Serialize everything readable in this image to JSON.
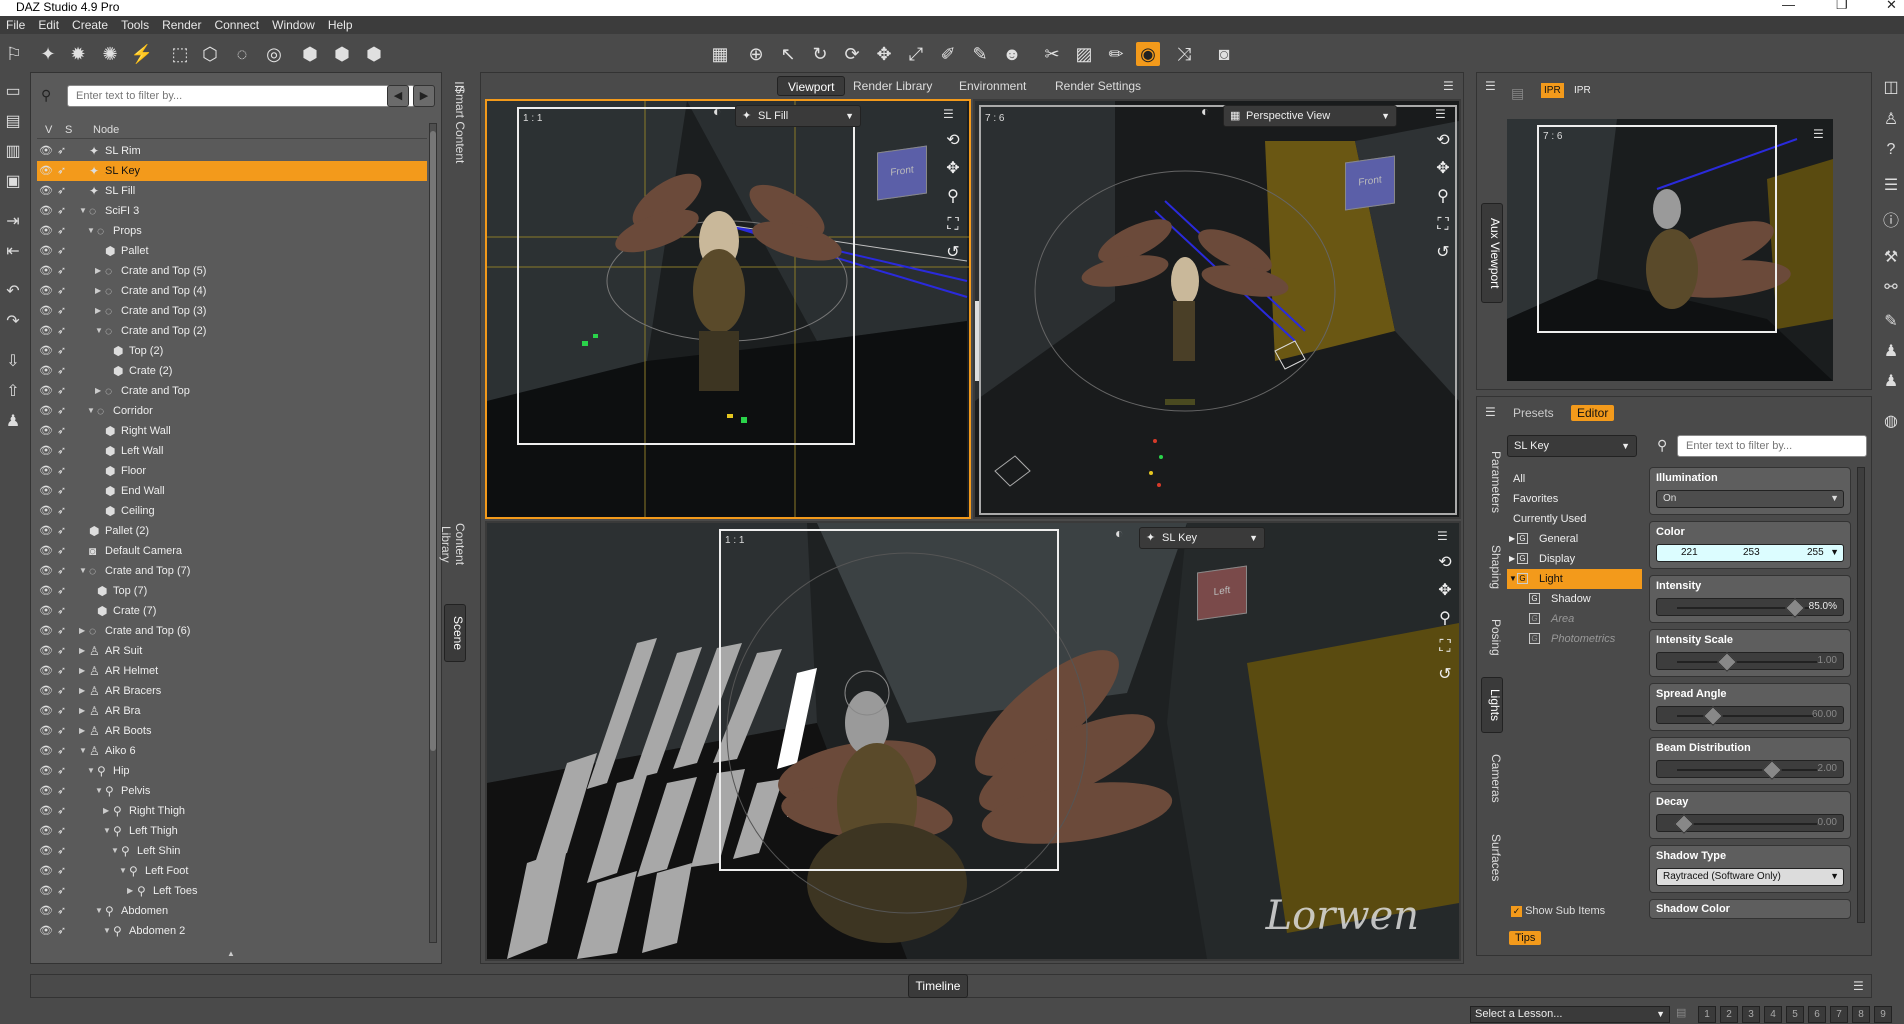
{
  "app": {
    "title": "DAZ Studio 4.9 Pro"
  },
  "menu": [
    "File",
    "Edit",
    "Create",
    "Tools",
    "Render",
    "Connect",
    "Window",
    "Help"
  ],
  "scene": {
    "filter_placeholder": "Enter text to filter by...",
    "headers": {
      "v": "V",
      "s": "S",
      "node": "Node"
    },
    "nodes": [
      {
        "label": "SL Rim",
        "depth": 0,
        "arrow": "",
        "icon": "spotlight"
      },
      {
        "label": "SL Key",
        "depth": 0,
        "arrow": "",
        "icon": "spotlight",
        "selected": true
      },
      {
        "label": "SL Fill",
        "depth": 0,
        "arrow": "",
        "icon": "spotlight"
      },
      {
        "label": "SciFI 3",
        "depth": 0,
        "arrow": "▼",
        "icon": "group"
      },
      {
        "label": "Props",
        "depth": 1,
        "arrow": "▼",
        "icon": "group"
      },
      {
        "label": "Pallet",
        "depth": 2,
        "arrow": "",
        "icon": "prop"
      },
      {
        "label": "Crate and Top (5)",
        "depth": 2,
        "arrow": "▶",
        "icon": "group"
      },
      {
        "label": "Crate and Top (4)",
        "depth": 2,
        "arrow": "▶",
        "icon": "group"
      },
      {
        "label": "Crate and Top (3)",
        "depth": 2,
        "arrow": "▶",
        "icon": "group"
      },
      {
        "label": "Crate and Top (2)",
        "depth": 2,
        "arrow": "▼",
        "icon": "group"
      },
      {
        "label": "Top (2)",
        "depth": 3,
        "arrow": "",
        "icon": "prop"
      },
      {
        "label": "Crate (2)",
        "depth": 3,
        "arrow": "",
        "icon": "prop"
      },
      {
        "label": "Crate and Top",
        "depth": 2,
        "arrow": "▶",
        "icon": "group"
      },
      {
        "label": "Corridor",
        "depth": 1,
        "arrow": "▼",
        "icon": "group"
      },
      {
        "label": "Right Wall",
        "depth": 2,
        "arrow": "",
        "icon": "prop"
      },
      {
        "label": "Left Wall",
        "depth": 2,
        "arrow": "",
        "icon": "prop"
      },
      {
        "label": "Floor",
        "depth": 2,
        "arrow": "",
        "icon": "prop"
      },
      {
        "label": "End Wall",
        "depth": 2,
        "arrow": "",
        "icon": "prop"
      },
      {
        "label": "Ceiling",
        "depth": 2,
        "arrow": "",
        "icon": "prop"
      },
      {
        "label": "Pallet (2)",
        "depth": 0,
        "arrow": "",
        "icon": "prop"
      },
      {
        "label": "Default Camera",
        "depth": 0,
        "arrow": "",
        "icon": "camera"
      },
      {
        "label": "Crate and Top (7)",
        "depth": 0,
        "arrow": "▼",
        "icon": "group"
      },
      {
        "label": "Top (7)",
        "depth": 1,
        "arrow": "",
        "icon": "prop"
      },
      {
        "label": "Crate (7)",
        "depth": 1,
        "arrow": "",
        "icon": "prop"
      },
      {
        "label": "Crate and Top (6)",
        "depth": 0,
        "arrow": "▶",
        "icon": "group"
      },
      {
        "label": "AR Suit",
        "depth": 0,
        "arrow": "▶",
        "icon": "figure"
      },
      {
        "label": "AR Helmet",
        "depth": 0,
        "arrow": "▶",
        "icon": "figure"
      },
      {
        "label": "AR Bracers",
        "depth": 0,
        "arrow": "▶",
        "icon": "figure"
      },
      {
        "label": "AR Bra",
        "depth": 0,
        "arrow": "▶",
        "icon": "figure"
      },
      {
        "label": "AR Boots",
        "depth": 0,
        "arrow": "▶",
        "icon": "figure"
      },
      {
        "label": "Aiko 6",
        "depth": 0,
        "arrow": "▼",
        "icon": "figure"
      },
      {
        "label": "Hip",
        "depth": 1,
        "arrow": "▼",
        "icon": "bone"
      },
      {
        "label": "Pelvis",
        "depth": 2,
        "arrow": "▼",
        "icon": "bone"
      },
      {
        "label": "Right Thigh",
        "depth": 3,
        "arrow": "▶",
        "icon": "bone"
      },
      {
        "label": "Left Thigh",
        "depth": 3,
        "arrow": "▼",
        "icon": "bone"
      },
      {
        "label": "Left Shin",
        "depth": 4,
        "arrow": "▼",
        "icon": "bone"
      },
      {
        "label": "Left Foot",
        "depth": 5,
        "arrow": "▼",
        "icon": "bone"
      },
      {
        "label": "Left Toes",
        "depth": 6,
        "arrow": "▶",
        "icon": "bone"
      },
      {
        "label": "Abdomen",
        "depth": 2,
        "arrow": "▼",
        "icon": "bone"
      },
      {
        "label": "Abdomen 2",
        "depth": 3,
        "arrow": "▼",
        "icon": "bone"
      }
    ],
    "side_tabs": [
      "Smart Content",
      "Content Library",
      "Scene"
    ]
  },
  "viewport": {
    "tabs": [
      "Viewport",
      "Render Library",
      "Environment",
      "Render Settings"
    ],
    "views": [
      {
        "camera": "SL Fill",
        "ratio": "1 : 1",
        "cube_label": "Front"
      },
      {
        "camera": "Perspective View",
        "ratio": "7 : 6",
        "cube_label": "Front"
      },
      {
        "camera": "SL Key",
        "ratio": "1 : 1",
        "cube_label": "Left"
      }
    ]
  },
  "aux": {
    "tab": "Aux Viewport",
    "ratio": "7 : 6",
    "btn1": "IPR",
    "btn2": "IPR"
  },
  "lights": {
    "tabs": [
      "Presets",
      "Editor"
    ],
    "node": "SL Key",
    "filter_placeholder": "Enter text to filter by...",
    "groups": [
      {
        "label": "All"
      },
      {
        "label": "Favorites"
      },
      {
        "label": "Currently Used"
      },
      {
        "label": "General",
        "icon": "G"
      },
      {
        "label": "Display",
        "icon": "G"
      },
      {
        "label": "Light",
        "icon": "G",
        "selected": true
      },
      {
        "label": "Shadow",
        "icon": "G"
      },
      {
        "label": "Area",
        "icon": "G",
        "dim": true
      },
      {
        "label": "Photometrics",
        "icon": "G",
        "dim": true
      }
    ],
    "show_sub_items": "Show Sub Items",
    "tips": "Tips",
    "side_tabs": [
      "Parameters",
      "Shaping",
      "Posing",
      "Lights",
      "Cameras",
      "Surfaces"
    ],
    "props": {
      "illumination": {
        "name": "Illumination",
        "value": "On"
      },
      "color": {
        "name": "Color",
        "r": "221",
        "g": "253",
        "b": "255"
      },
      "intensity": {
        "name": "Intensity",
        "value": "85.0%",
        "level": 0.85
      },
      "intensity_scale": {
        "name": "Intensity Scale",
        "value": "1.00",
        "level": 0.33
      },
      "spread_angle": {
        "name": "Spread Angle",
        "value": "60.00",
        "level": 0.22
      },
      "beam_distribution": {
        "name": "Beam Distribution",
        "value": "2.00",
        "level": 0.68
      },
      "decay": {
        "name": "Decay",
        "value": "0.00",
        "level": 0.0
      },
      "shadow_type": {
        "name": "Shadow Type",
        "value": "Raytraced (Software Only)"
      },
      "shadow_color": {
        "name": "Shadow Color"
      }
    }
  },
  "timeline": {
    "label": "Timeline"
  },
  "status": {
    "lesson": "Select a Lesson...",
    "pages": [
      "1",
      "2",
      "3",
      "4",
      "5",
      "6",
      "7",
      "8",
      "9"
    ]
  },
  "watermark": "Lorwen",
  "colors": {
    "accent": "#f39a1b",
    "panel": "#5a5a5a",
    "dark": "#3a3a3a"
  }
}
